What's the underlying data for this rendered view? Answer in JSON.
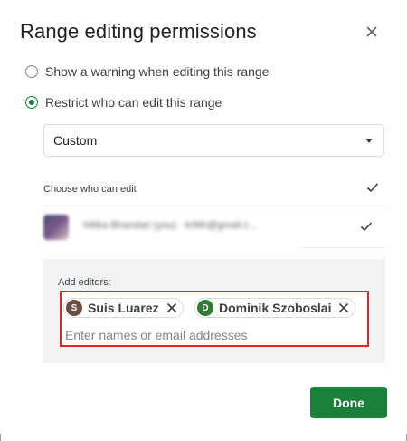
{
  "dialog": {
    "title": "Range editing permissions",
    "close_icon": "close-icon"
  },
  "options": {
    "warning_label": "Show a warning when editing this range",
    "warning_selected": false,
    "restrict_label": "Restrict who can edit this range",
    "restrict_selected": true
  },
  "access_select": {
    "value": "Custom"
  },
  "choose": {
    "label": "Choose who can edit",
    "select_all_checked": true
  },
  "current_user": {
    "text": "Nitika Bhandari (you) · kr8th@gmail.c...",
    "checked": true
  },
  "editors": {
    "label": "Add editors:",
    "chips": [
      {
        "initial": "S",
        "name": "Suis Luarez",
        "color": "#6d4c41"
      },
      {
        "initial": "D",
        "name": "Dominik Szoboslai",
        "color": "#2e7d32"
      }
    ],
    "input_placeholder": "Enter names or email addresses"
  },
  "actions": {
    "done_label": "Done"
  },
  "colors": {
    "accent": "#188038",
    "highlight_border": "#e52421"
  }
}
